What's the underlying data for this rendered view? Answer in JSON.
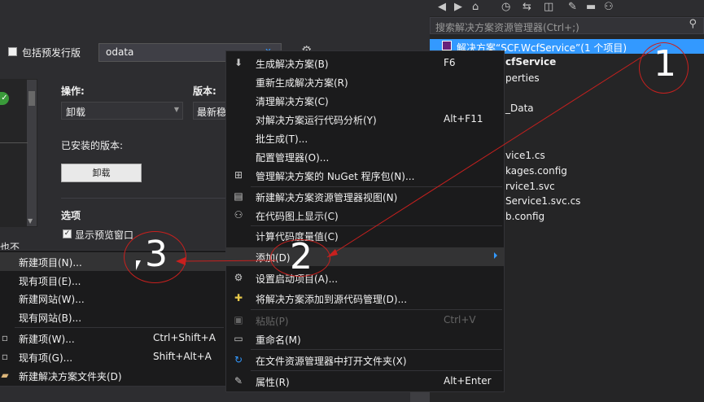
{
  "nuget": {
    "prerelease_label": "包括预发行版",
    "search_value": "odata",
    "clear_glyph": "x",
    "operation_label": "操作:",
    "operation_value": "卸载",
    "version_label": "版本:",
    "version_value": "最新稳",
    "installed_label": "已安装的版本:",
    "uninstall_button": "卸载",
    "options_label": "选项",
    "preview_label": "显示预览窗口",
    "cutoff_text": "也不"
  },
  "solution_explorer": {
    "search_placeholder": "搜索解决方案资源管理器(Ctrl+;)",
    "solution_label": "解决方案“SCF.WcfService”(1 个项目)",
    "items": [
      "cfService",
      "perties",
      "",
      "_Data",
      "",
      "vice1.cs",
      "kages.config",
      "rvice1.svc",
      "Service1.svc.cs",
      "b.config"
    ]
  },
  "solution_menu": {
    "items": [
      {
        "label": "生成解决方案(B)",
        "shortcut": "F6",
        "icon": "build-icon"
      },
      {
        "label": "重新生成解决方案(R)",
        "shortcut": ""
      },
      {
        "label": "清理解决方案(C)",
        "shortcut": ""
      },
      {
        "label": "对解决方案运行代码分析(Y)",
        "shortcut": "Alt+F11"
      },
      {
        "label": "批生成(T)...",
        "shortcut": ""
      },
      {
        "label": "配置管理器(O)...",
        "shortcut": ""
      },
      {
        "label": "管理解决方案的 NuGet 程序包(N)...",
        "shortcut": "",
        "icon": "nuget-icon"
      },
      {
        "label": "新建解决方案资源管理器视图(N)",
        "shortcut": "",
        "icon": "new-view-icon"
      },
      {
        "label": "在代码图上显示(C)",
        "shortcut": "",
        "icon": "code-map-icon"
      },
      {
        "label": "计算代码度量值(C)",
        "shortcut": ""
      },
      {
        "label": "添加(D)",
        "shortcut": ""
      },
      {
        "label": "设置启动项目(A)...",
        "shortcut": "",
        "icon": "gear-icon"
      },
      {
        "label": "将解决方案添加到源代码管理(D)...",
        "shortcut": "",
        "icon": "source-control-icon"
      },
      {
        "label": "粘贴(P)",
        "shortcut": "Ctrl+V",
        "icon": "paste-icon",
        "disabled": true
      },
      {
        "label": "重命名(M)",
        "shortcut": "",
        "icon": "rename-icon"
      },
      {
        "label": "在文件资源管理器中打开文件夹(X)",
        "shortcut": "",
        "icon": "refresh-icon"
      },
      {
        "label": "属性(R)",
        "shortcut": "Alt+Enter",
        "icon": "wrench-icon"
      }
    ]
  },
  "add_submenu": {
    "items": [
      {
        "label": "新建项目(N)...",
        "shortcut": ""
      },
      {
        "label": "现有项目(E)...",
        "shortcut": ""
      },
      {
        "label": "新建网站(W)...",
        "shortcut": ""
      },
      {
        "label": "现有网站(B)...",
        "shortcut": ""
      },
      {
        "label": "新建项(W)...",
        "shortcut": "Ctrl+Shift+A"
      },
      {
        "label": "现有项(G)...",
        "shortcut": "Shift+Alt+A"
      },
      {
        "label": "新建解决方案文件夹(D)",
        "shortcut": ""
      }
    ]
  },
  "annotations": [
    "1",
    "2",
    "3"
  ],
  "colors": {
    "accent": "#3399ff",
    "annotation": "#c8201e"
  }
}
